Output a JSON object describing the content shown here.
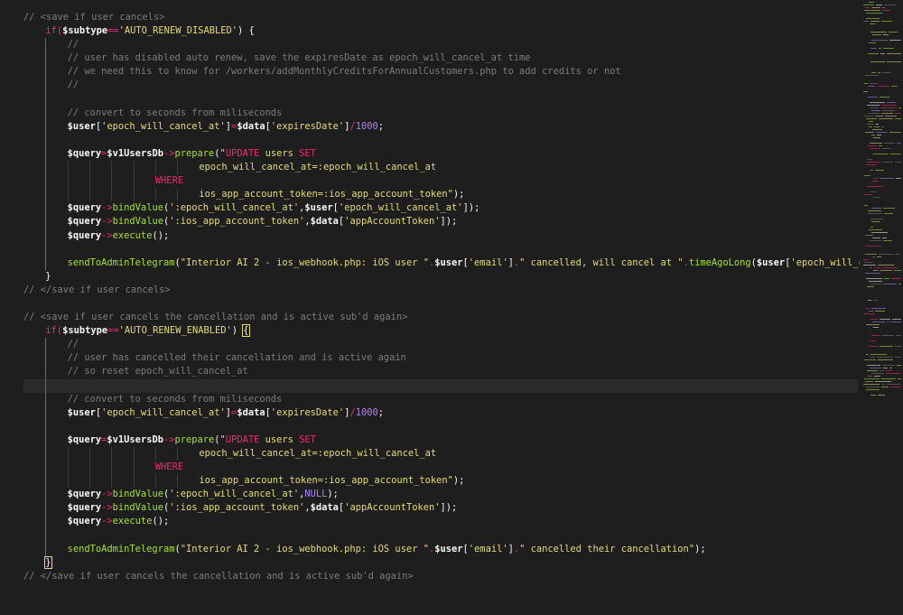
{
  "editor": {
    "language": "php",
    "current_line_index": 27,
    "lines": [
      {
        "indent": 0,
        "tokens": [
          {
            "t": "// <save if user cancels>",
            "c": "comment"
          }
        ]
      },
      {
        "indent": 1,
        "tokens": [
          {
            "t": "if(",
            "c": "keyword"
          },
          {
            "t": "$subtype",
            "c": "var"
          },
          {
            "t": "==",
            "c": "op"
          },
          {
            "t": "'AUTO_RENEW_DISABLED'",
            "c": "string"
          },
          {
            "t": ") {",
            "c": "punct"
          }
        ]
      },
      {
        "indent": 2,
        "tokens": [
          {
            "t": "//",
            "c": "comment"
          }
        ]
      },
      {
        "indent": 2,
        "tokens": [
          {
            "t": "// user has disabled auto renew, save the expiresDate as epoch_will_cancel_at time",
            "c": "comment"
          }
        ]
      },
      {
        "indent": 2,
        "tokens": [
          {
            "t": "// we need this to know for /workers/addMonthlyCreditsForAnnualCustomers.php to add credits or not",
            "c": "comment"
          }
        ]
      },
      {
        "indent": 2,
        "tokens": [
          {
            "t": "//",
            "c": "comment"
          }
        ]
      },
      {
        "indent": 2,
        "tokens": []
      },
      {
        "indent": 2,
        "tokens": [
          {
            "t": "// convert to seconds from miliseconds",
            "c": "comment"
          }
        ]
      },
      {
        "indent": 2,
        "tokens": [
          {
            "t": "$user",
            "c": "var"
          },
          {
            "t": "[",
            "c": "punct"
          },
          {
            "t": "'epoch_will_cancel_at'",
            "c": "string"
          },
          {
            "t": "]",
            "c": "punct"
          },
          {
            "t": "=",
            "c": "op"
          },
          {
            "t": "$data",
            "c": "var"
          },
          {
            "t": "[",
            "c": "punct"
          },
          {
            "t": "'expiresDate'",
            "c": "string"
          },
          {
            "t": "]",
            "c": "punct"
          },
          {
            "t": "/",
            "c": "op"
          },
          {
            "t": "1000",
            "c": "number"
          },
          {
            "t": ";",
            "c": "punct"
          }
        ]
      },
      {
        "indent": 2,
        "tokens": []
      },
      {
        "indent": 2,
        "tokens": [
          {
            "t": "$query",
            "c": "var"
          },
          {
            "t": "=",
            "c": "op"
          },
          {
            "t": "$v1UsersDb",
            "c": "var"
          },
          {
            "t": "->",
            "c": "op"
          },
          {
            "t": "prepare",
            "c": "func"
          },
          {
            "t": "(",
            "c": "punct"
          },
          {
            "t": "\"",
            "c": "string"
          },
          {
            "t": "UPDATE",
            "c": "string-kw"
          },
          {
            "t": " users ",
            "c": "string"
          },
          {
            "t": "SET",
            "c": "string-kw"
          }
        ]
      },
      {
        "indent": 8,
        "tokens": [
          {
            "t": "epoch_will_cancel_at=:epoch_will_cancel_at",
            "c": "string"
          }
        ]
      },
      {
        "indent": 6,
        "tokens": [
          {
            "t": "WHERE",
            "c": "string-kw"
          }
        ]
      },
      {
        "indent": 8,
        "tokens": [
          {
            "t": "ios_app_account_token=:ios_app_account_token\"",
            "c": "string"
          },
          {
            "t": ");",
            "c": "punct"
          }
        ]
      },
      {
        "indent": 2,
        "tokens": [
          {
            "t": "$query",
            "c": "var"
          },
          {
            "t": "->",
            "c": "op"
          },
          {
            "t": "bindValue",
            "c": "func"
          },
          {
            "t": "(",
            "c": "punct"
          },
          {
            "t": "':epoch_will_cancel_at'",
            "c": "string"
          },
          {
            "t": ",",
            "c": "punct"
          },
          {
            "t": "$user",
            "c": "var"
          },
          {
            "t": "[",
            "c": "punct"
          },
          {
            "t": "'epoch_will_cancel_at'",
            "c": "string"
          },
          {
            "t": "]);",
            "c": "punct"
          }
        ]
      },
      {
        "indent": 2,
        "tokens": [
          {
            "t": "$query",
            "c": "var"
          },
          {
            "t": "->",
            "c": "op"
          },
          {
            "t": "bindValue",
            "c": "func"
          },
          {
            "t": "(",
            "c": "punct"
          },
          {
            "t": "':ios_app_account_token'",
            "c": "string"
          },
          {
            "t": ",",
            "c": "punct"
          },
          {
            "t": "$data",
            "c": "var"
          },
          {
            "t": "[",
            "c": "punct"
          },
          {
            "t": "'appAccountToken'",
            "c": "string"
          },
          {
            "t": "]);",
            "c": "punct"
          }
        ]
      },
      {
        "indent": 2,
        "tokens": [
          {
            "t": "$query",
            "c": "var"
          },
          {
            "t": "->",
            "c": "op"
          },
          {
            "t": "execute",
            "c": "func"
          },
          {
            "t": "();",
            "c": "punct"
          }
        ]
      },
      {
        "indent": 2,
        "tokens": []
      },
      {
        "indent": 2,
        "tokens": [
          {
            "t": "sendToAdminTelegram",
            "c": "func"
          },
          {
            "t": "(",
            "c": "punct"
          },
          {
            "t": "\"Interior AI 2 - ios_webhook.php: iOS user \"",
            "c": "string"
          },
          {
            "t": ".",
            "c": "op"
          },
          {
            "t": "$user",
            "c": "var"
          },
          {
            "t": "[",
            "c": "punct"
          },
          {
            "t": "'email'",
            "c": "string"
          },
          {
            "t": "]",
            "c": "punct"
          },
          {
            "t": ".",
            "c": "op"
          },
          {
            "t": "\" cancelled, will cancel at \"",
            "c": "string"
          },
          {
            "t": ".",
            "c": "op"
          },
          {
            "t": "timeAgoLong",
            "c": "func"
          },
          {
            "t": "(",
            "c": "punct"
          },
          {
            "t": "$user",
            "c": "var"
          },
          {
            "t": "[",
            "c": "punct"
          },
          {
            "t": "'epoch_will_cance",
            "c": "string"
          }
        ]
      },
      {
        "indent": 1,
        "tokens": [
          {
            "t": "}",
            "c": "punct"
          }
        ]
      },
      {
        "indent": 0,
        "tokens": [
          {
            "t": "// </save if user cancels>",
            "c": "comment"
          }
        ]
      },
      {
        "indent": 0,
        "tokens": []
      },
      {
        "indent": 0,
        "tokens": [
          {
            "t": "// <save if user cancels the cancellation and is active sub'd again>",
            "c": "comment"
          }
        ]
      },
      {
        "indent": 1,
        "tokens": [
          {
            "t": "if(",
            "c": "keyword"
          },
          {
            "t": "$subtype",
            "c": "var"
          },
          {
            "t": "==",
            "c": "op"
          },
          {
            "t": "'AUTO_RENEW_ENABLED'",
            "c": "string"
          },
          {
            "t": ") ",
            "c": "punct"
          },
          {
            "t": "{",
            "c": "bracket-match"
          }
        ]
      },
      {
        "indent": 2,
        "tokens": [
          {
            "t": "//",
            "c": "comment"
          }
        ]
      },
      {
        "indent": 2,
        "tokens": [
          {
            "t": "// user has cancelled their cancellation and is active again",
            "c": "comment"
          }
        ]
      },
      {
        "indent": 2,
        "tokens": [
          {
            "t": "// so reset epoch_will_cancel_at",
            "c": "comment"
          }
        ]
      },
      {
        "indent": 0,
        "tokens": []
      },
      {
        "indent": 2,
        "tokens": [
          {
            "t": "// convert to seconds from miliseconds",
            "c": "comment"
          }
        ]
      },
      {
        "indent": 2,
        "tokens": [
          {
            "t": "$user",
            "c": "var"
          },
          {
            "t": "[",
            "c": "punct"
          },
          {
            "t": "'epoch_will_cancel_at'",
            "c": "string"
          },
          {
            "t": "]",
            "c": "punct"
          },
          {
            "t": "=",
            "c": "op"
          },
          {
            "t": "$data",
            "c": "var"
          },
          {
            "t": "[",
            "c": "punct"
          },
          {
            "t": "'expiresDate'",
            "c": "string"
          },
          {
            "t": "]",
            "c": "punct"
          },
          {
            "t": "/",
            "c": "op"
          },
          {
            "t": "1000",
            "c": "number"
          },
          {
            "t": ";",
            "c": "punct"
          }
        ]
      },
      {
        "indent": 2,
        "tokens": []
      },
      {
        "indent": 2,
        "tokens": [
          {
            "t": "$query",
            "c": "var"
          },
          {
            "t": "=",
            "c": "op"
          },
          {
            "t": "$v1UsersDb",
            "c": "var"
          },
          {
            "t": "->",
            "c": "op"
          },
          {
            "t": "prepare",
            "c": "func"
          },
          {
            "t": "(",
            "c": "punct"
          },
          {
            "t": "\"",
            "c": "string"
          },
          {
            "t": "UPDATE",
            "c": "string-kw"
          },
          {
            "t": " users ",
            "c": "string"
          },
          {
            "t": "SET",
            "c": "string-kw"
          }
        ]
      },
      {
        "indent": 8,
        "tokens": [
          {
            "t": "epoch_will_cancel_at=:epoch_will_cancel_at",
            "c": "string"
          }
        ]
      },
      {
        "indent": 6,
        "tokens": [
          {
            "t": "WHERE",
            "c": "string-kw"
          }
        ]
      },
      {
        "indent": 8,
        "tokens": [
          {
            "t": "ios_app_account_token=:ios_app_account_token\"",
            "c": "string"
          },
          {
            "t": ");",
            "c": "punct"
          }
        ]
      },
      {
        "indent": 2,
        "tokens": [
          {
            "t": "$query",
            "c": "var"
          },
          {
            "t": "->",
            "c": "op"
          },
          {
            "t": "bindValue",
            "c": "func"
          },
          {
            "t": "(",
            "c": "punct"
          },
          {
            "t": "':epoch_will_cancel_at'",
            "c": "string"
          },
          {
            "t": ",",
            "c": "punct"
          },
          {
            "t": "NULL",
            "c": "const"
          },
          {
            "t": ");",
            "c": "punct"
          }
        ]
      },
      {
        "indent": 2,
        "tokens": [
          {
            "t": "$query",
            "c": "var"
          },
          {
            "t": "->",
            "c": "op"
          },
          {
            "t": "bindValue",
            "c": "func"
          },
          {
            "t": "(",
            "c": "punct"
          },
          {
            "t": "':ios_app_account_token'",
            "c": "string"
          },
          {
            "t": ",",
            "c": "punct"
          },
          {
            "t": "$data",
            "c": "var"
          },
          {
            "t": "[",
            "c": "punct"
          },
          {
            "t": "'appAccountToken'",
            "c": "string"
          },
          {
            "t": "]);",
            "c": "punct"
          }
        ]
      },
      {
        "indent": 2,
        "tokens": [
          {
            "t": "$query",
            "c": "var"
          },
          {
            "t": "->",
            "c": "op"
          },
          {
            "t": "execute",
            "c": "func"
          },
          {
            "t": "();",
            "c": "punct"
          }
        ]
      },
      {
        "indent": 2,
        "tokens": []
      },
      {
        "indent": 2,
        "tokens": [
          {
            "t": "sendToAdminTelegram",
            "c": "func"
          },
          {
            "t": "(",
            "c": "punct"
          },
          {
            "t": "\"Interior AI 2 - ios_webhook.php: iOS user \"",
            "c": "string"
          },
          {
            "t": ".",
            "c": "op"
          },
          {
            "t": "$user",
            "c": "var"
          },
          {
            "t": "[",
            "c": "punct"
          },
          {
            "t": "'email'",
            "c": "string"
          },
          {
            "t": "]",
            "c": "punct"
          },
          {
            "t": ".",
            "c": "op"
          },
          {
            "t": "\" cancelled their cancellation\"",
            "c": "string"
          },
          {
            "t": ");",
            "c": "punct"
          }
        ]
      },
      {
        "indent": 1,
        "tokens": [
          {
            "t": "}",
            "c": "bracket-match"
          }
        ]
      },
      {
        "indent": 0,
        "tokens": [
          {
            "t": "// </save if user cancels the cancellation and is active sub'd again>",
            "c": "comment"
          }
        ]
      }
    ]
  },
  "colors": {
    "background": "#1e1e1e",
    "comment": "#7c7c7c",
    "keyword": "#f92672",
    "string": "#e6db74",
    "function": "#a6e22e",
    "number": "#ae81ff",
    "variable": "#f8f8f2"
  }
}
